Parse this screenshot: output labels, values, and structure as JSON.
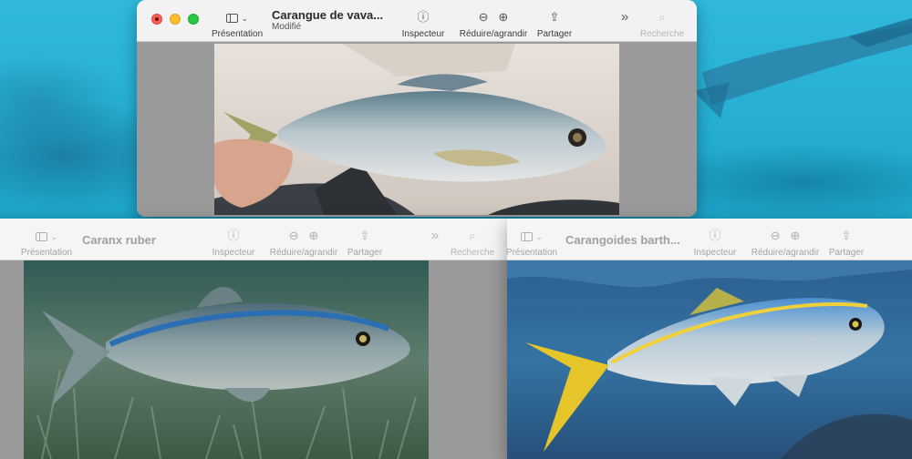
{
  "windows": {
    "top": {
      "title": "Carangue de  vava...",
      "subtitle": "Modifié",
      "toolbar": {
        "presentation": "Présentation",
        "inspector": "Inspecteur",
        "zoom": "Réduire/agrandir",
        "share": "Partager",
        "search": "Recherche"
      }
    },
    "left": {
      "title": "Caranx ruber",
      "toolbar": {
        "presentation": "Présentation",
        "inspector": "Inspecteur",
        "zoom": "Réduire/agrandir",
        "share": "Partager",
        "search": "Recherche"
      }
    },
    "right": {
      "title": "Carangoides barth...",
      "toolbar": {
        "presentation": "Présentation",
        "inspector": "Inspecteur",
        "zoom": "Réduire/agrandir",
        "share": "Partager"
      }
    }
  },
  "icons": {
    "sidebar": "sidebar-icon",
    "chevron": "chevron-down-icon",
    "info": "info-icon",
    "zoom_out": "zoom-out-icon",
    "zoom_in": "zoom-in-icon",
    "share": "share-icon",
    "more": "more-chevrons-icon",
    "search": "search-icon"
  },
  "colors": {
    "close": "#fe5f57",
    "minimize": "#febc2e",
    "maximize": "#28c840"
  }
}
